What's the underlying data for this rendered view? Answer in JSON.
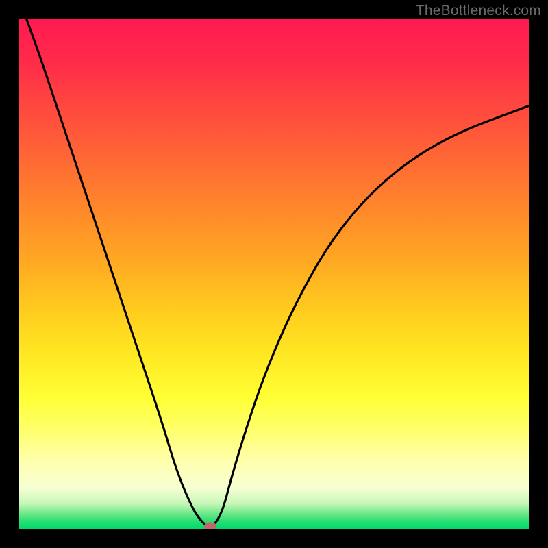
{
  "watermark": "TheBottleneck.com",
  "colors": {
    "frame": "#000000",
    "curve": "#000000",
    "marker": "#c06868"
  },
  "chart_data": {
    "type": "line",
    "title": "",
    "xlabel": "",
    "ylabel": "",
    "xlim": [
      0,
      1
    ],
    "ylim": [
      0,
      1
    ],
    "grid": false,
    "series": [
      {
        "name": "bottleneck-curve",
        "x": [
          0.0,
          0.04,
          0.08,
          0.12,
          0.16,
          0.2,
          0.24,
          0.28,
          0.31,
          0.34,
          0.355,
          0.365,
          0.375,
          0.385,
          0.4,
          0.415,
          0.44,
          0.48,
          0.54,
          0.62,
          0.72,
          0.84,
          1.0
        ],
        "y": [
          1.04,
          0.93,
          0.81,
          0.69,
          0.57,
          0.45,
          0.33,
          0.21,
          0.11,
          0.04,
          0.018,
          0.008,
          0.004,
          0.01,
          0.038,
          0.095,
          0.18,
          0.3,
          0.44,
          0.58,
          0.69,
          0.77,
          0.83
        ]
      }
    ],
    "marker": {
      "x": 0.375,
      "y": 0.004
    },
    "background_gradient_stops": [
      {
        "pos": 0.0,
        "color": "#ff1a52"
      },
      {
        "pos": 0.5,
        "color": "#ffaa22"
      },
      {
        "pos": 0.75,
        "color": "#ffff33"
      },
      {
        "pos": 0.95,
        "color": "#c8f7b8"
      },
      {
        "pos": 1.0,
        "color": "#00d96c"
      }
    ]
  }
}
